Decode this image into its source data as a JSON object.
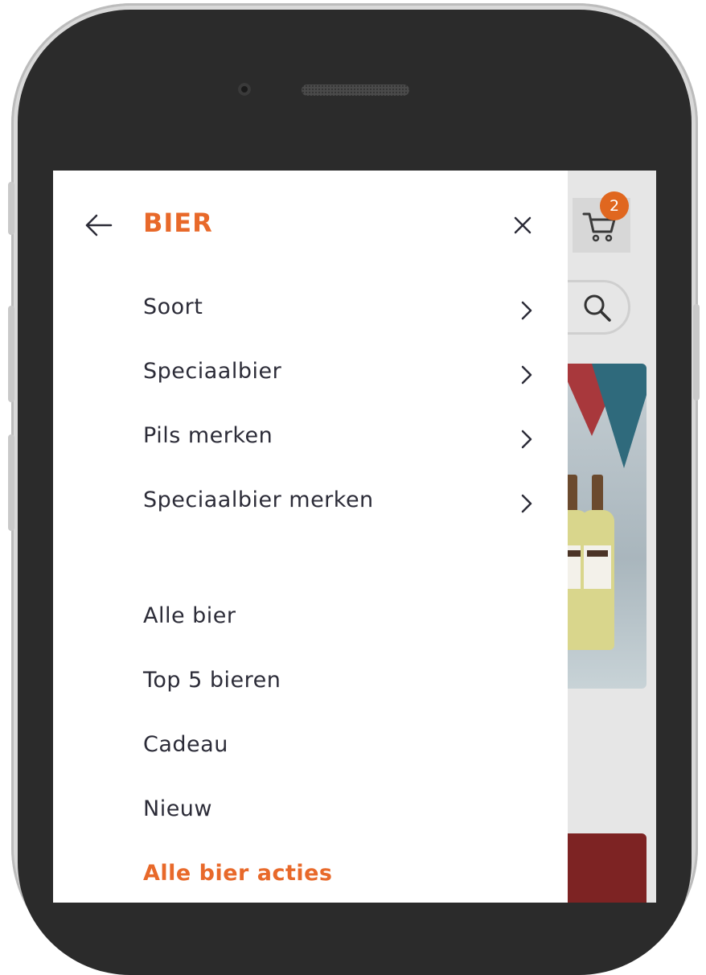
{
  "header": {
    "title": "BIER",
    "cart_count": "2"
  },
  "submenu": [
    {
      "label": "Soort"
    },
    {
      "label": "Speciaalbier"
    },
    {
      "label": "Pils merken"
    },
    {
      "label": "Speciaalbier merken"
    }
  ],
  "links": [
    {
      "label": "Alle bier"
    },
    {
      "label": "Top 5 bieren"
    },
    {
      "label": "Cadeau"
    },
    {
      "label": "Nieuw"
    }
  ],
  "accent_link": {
    "label": "Alle bier acties"
  },
  "colors": {
    "accent": "#e8692a",
    "text": "#2c2c38",
    "badge": "#e0671f",
    "frame": "#2b2b2b"
  },
  "icons": {
    "back": "arrow-left-icon",
    "close": "close-icon",
    "chevron": "chevron-right-icon",
    "cart": "cart-icon",
    "search": "search-icon"
  }
}
